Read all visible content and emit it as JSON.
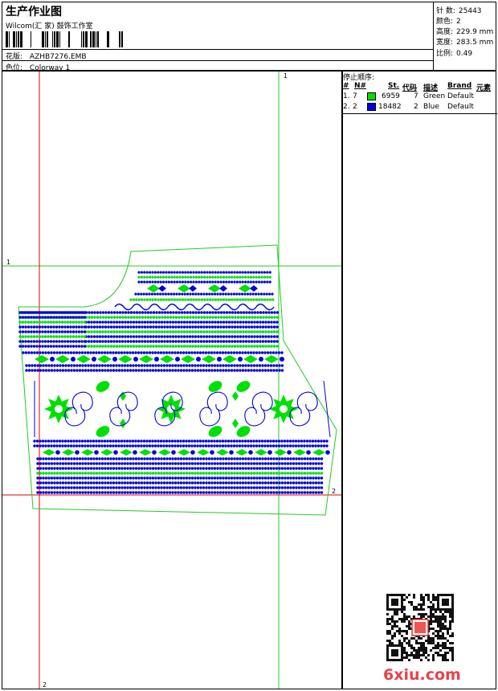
{
  "header": {
    "title": "生产作业图",
    "company": "Wilcom(汇 家) 鼓饰工作室",
    "design_label": "花版:",
    "design_value": "AZHB7276.EMB",
    "colorway_label": "色位:",
    "colorway_value": "Colorway 1"
  },
  "info": {
    "stitches_label": "针 数:",
    "stitches_value": "25443",
    "colors_label": "颜色:",
    "colors_value": "2",
    "height_label": "高度:",
    "height_value": "229.9 mm",
    "width_label": "宽度:",
    "width_value": "283.5 mm",
    "scale_label": "比例:",
    "scale_value": "0.49"
  },
  "guides": {
    "top_marker": "1",
    "left_marker": "1",
    "right_marker": "2",
    "bottom_marker": "2"
  },
  "stop_sequence": {
    "title": "停止顺序:",
    "columns": [
      "#",
      "N#",
      "St.",
      "代码",
      "描述",
      "Brand",
      "元素"
    ],
    "rows": [
      {
        "idx": "1.",
        "n": "7",
        "color": "#00e000",
        "st": "6959",
        "code": "7",
        "desc": "Green",
        "brand": "Default"
      },
      {
        "idx": "2.",
        "n": "2",
        "color": "#0000e0",
        "st": "18482",
        "code": "2",
        "desc": "Blue",
        "brand": "Default"
      }
    ]
  },
  "watermark": "6xiu.com",
  "colors": {
    "green": "#00e000",
    "blue": "#0000e0",
    "outline": "#22cc22",
    "guide_red": "#e00000"
  }
}
